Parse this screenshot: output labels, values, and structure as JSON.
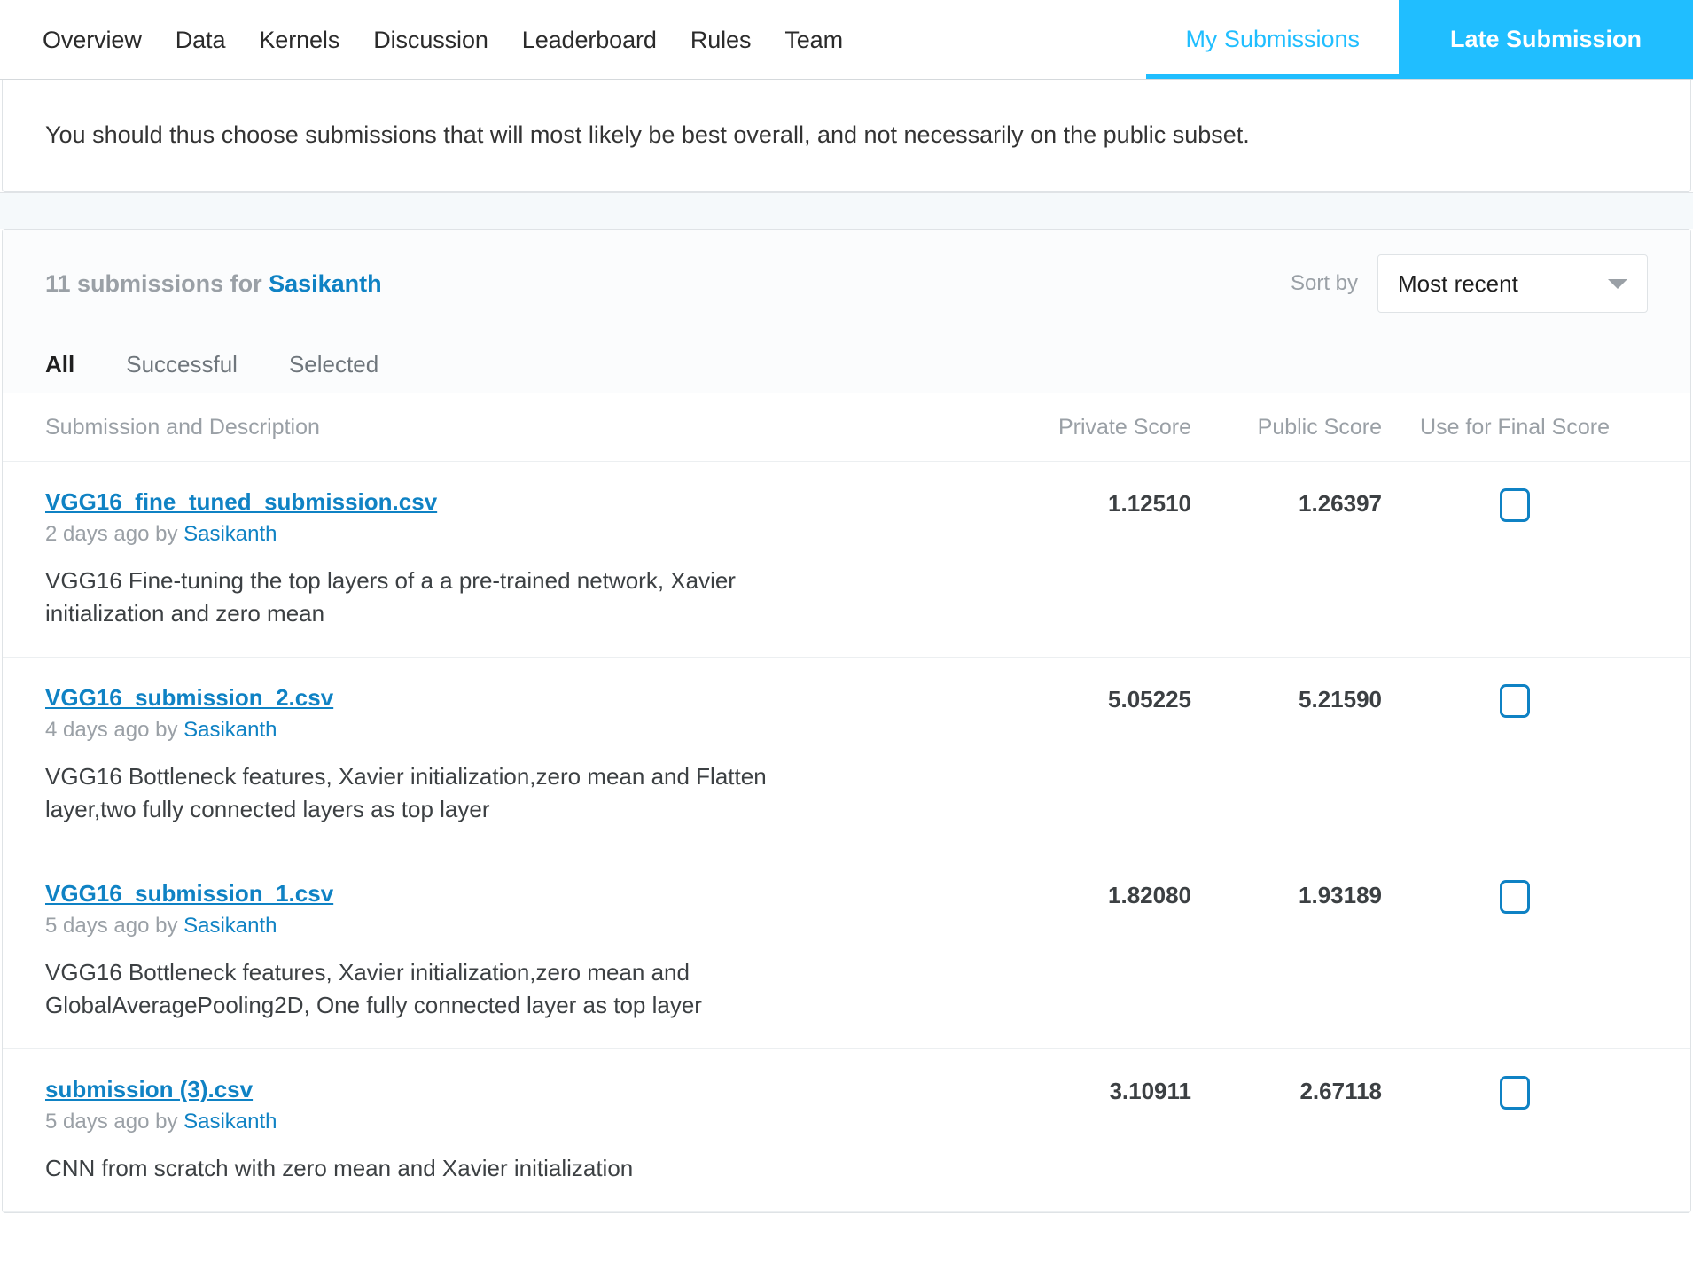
{
  "nav": {
    "items": [
      {
        "label": "Overview"
      },
      {
        "label": "Data"
      },
      {
        "label": "Kernels"
      },
      {
        "label": "Discussion"
      },
      {
        "label": "Leaderboard"
      },
      {
        "label": "Rules"
      },
      {
        "label": "Team"
      }
    ],
    "active_tab": "My Submissions",
    "cta_label": "Late Submission",
    "accent_color": "#20beff"
  },
  "notice": {
    "text": "You should thus choose submissions that will most likely be best overall, and not necessarily on the public subset."
  },
  "submissions_panel": {
    "count_text": "11 submissions for",
    "user": "Sasikanth",
    "sort_label": "Sort by",
    "sort_value": "Most recent",
    "sort_icon": "chevron-down-icon",
    "filters": [
      {
        "label": "All",
        "active": true
      },
      {
        "label": "Successful",
        "active": false
      },
      {
        "label": "Selected",
        "active": false
      }
    ],
    "columns": {
      "description": "Submission and Description",
      "private": "Private Score",
      "public": "Public Score",
      "final": "Use for Final Score"
    },
    "rows": [
      {
        "filename": "VGG16_fine_tuned_submission.csv",
        "time": "2 days ago by",
        "author": "Sasikanth",
        "description": "VGG16 Fine-tuning the top layers of a a pre-trained network, Xavier initialization and zero mean",
        "private_score": "1.12510",
        "public_score": "1.26397",
        "checked": false
      },
      {
        "filename": "VGG16_submission_2.csv",
        "time": "4 days ago by",
        "author": "Sasikanth",
        "description": "VGG16 Bottleneck features, Xavier initialization,zero mean and Flatten layer,two fully connected layers as top layer",
        "private_score": "5.05225",
        "public_score": "5.21590",
        "checked": false
      },
      {
        "filename": "VGG16_submission_1.csv",
        "time": "5 days ago by",
        "author": "Sasikanth",
        "description": "VGG16 Bottleneck features, Xavier initialization,zero mean and GlobalAveragePooling2D, One fully connected layer as top layer",
        "private_score": "1.82080",
        "public_score": "1.93189",
        "checked": false
      },
      {
        "filename": "submission (3).csv",
        "time": "5 days ago by",
        "author": "Sasikanth",
        "description": "CNN from scratch with zero mean and Xavier initialization",
        "private_score": "3.10911",
        "public_score": "2.67118",
        "checked": false
      }
    ]
  }
}
